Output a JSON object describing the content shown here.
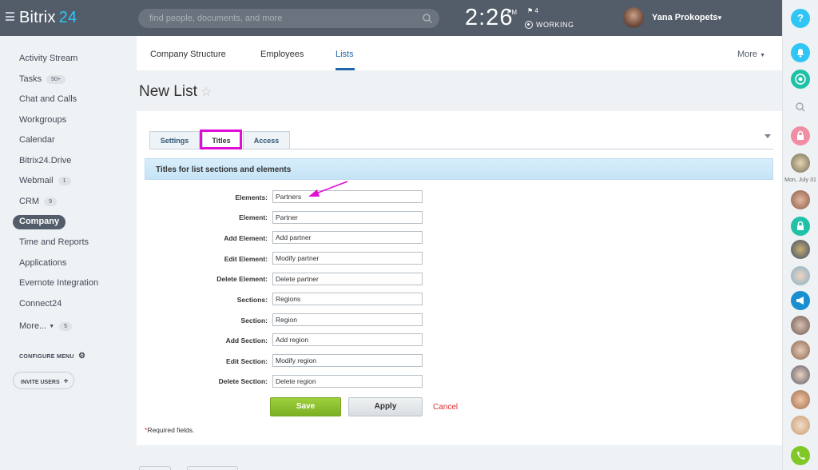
{
  "header": {
    "logo_text": "Bitrix",
    "logo_num": "24",
    "search_placeholder": "find people, documents, and more",
    "time": "2:26",
    "ampm": "PM",
    "flag_count": "4",
    "status": "WORKING",
    "user_name": "Yana Prokopets"
  },
  "rightbar": {
    "help": "?",
    "date_label": "Mon, July 31"
  },
  "sidebar": {
    "items": [
      {
        "label": "Activity Stream",
        "badge": ""
      },
      {
        "label": "Tasks",
        "badge": "50+"
      },
      {
        "label": "Chat and Calls",
        "badge": ""
      },
      {
        "label": "Workgroups",
        "badge": ""
      },
      {
        "label": "Calendar",
        "badge": ""
      },
      {
        "label": "Bitrix24.Drive",
        "badge": ""
      },
      {
        "label": "Webmail",
        "badge": "1"
      },
      {
        "label": "CRM",
        "badge": "9"
      },
      {
        "label": "Company",
        "badge": ""
      },
      {
        "label": "Time and Reports",
        "badge": ""
      },
      {
        "label": "Applications",
        "badge": ""
      },
      {
        "label": "Evernote Integration",
        "badge": ""
      },
      {
        "label": "Connect24",
        "badge": ""
      },
      {
        "label": "More...",
        "badge": "5"
      }
    ],
    "configure_menu": "CONFIGURE MENU",
    "invite_users": "INVITE USERS"
  },
  "top_tabs": {
    "items": [
      "Company Structure",
      "Employees",
      "Lists"
    ],
    "active": "Lists",
    "more": "More"
  },
  "page": {
    "title": "New List"
  },
  "form": {
    "tabs": [
      "Settings",
      "Titles",
      "Access"
    ],
    "active_tab": "Titles",
    "section_title": "Titles for list sections and elements",
    "fields": [
      {
        "label": "Elements:",
        "value": "Partners"
      },
      {
        "label": "Element:",
        "value": "Partner"
      },
      {
        "label": "Add Element:",
        "value": "Add partner"
      },
      {
        "label": "Edit Element:",
        "value": "Modify partner"
      },
      {
        "label": "Delete Element:",
        "value": "Delete partner"
      },
      {
        "label": "Sections:",
        "value": "Regions"
      },
      {
        "label": "Section:",
        "value": "Region"
      },
      {
        "label": "Add Section:",
        "value": "Add region"
      },
      {
        "label": "Edit Section:",
        "value": "Modify region"
      },
      {
        "label": "Delete Section:",
        "value": "Delete region"
      }
    ],
    "save": "Save",
    "apply": "Apply",
    "cancel": "Cancel",
    "required_star": "*",
    "required_note": "Required fields."
  },
  "colors": {
    "topbar": "#535c69",
    "accent": "#2fc6f6",
    "link_active": "#2067b0",
    "highlight": "#e10ed6",
    "save_green": "#8ec232",
    "cancel_red": "#e02c2c"
  }
}
